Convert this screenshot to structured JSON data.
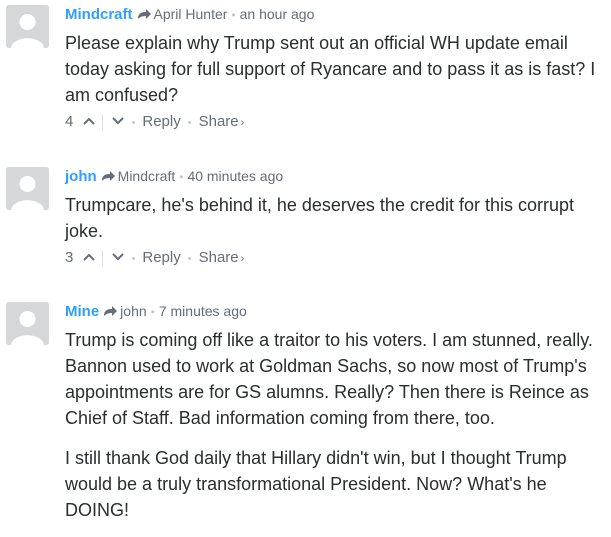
{
  "colors": {
    "author": "#2e9fff",
    "meta": "#656c7a",
    "text": "#2a2e2e",
    "avatar_bg": "#d5d7d8"
  },
  "comments": [
    {
      "author": "Mindcraft",
      "parent": "April Hunter",
      "time": "an hour ago",
      "paragraphs": [
        "Please explain why Trump sent out an official WH update email today asking for full support of Ryancare and to pass it as is fast? I am confused?"
      ],
      "upvotes": "4",
      "reply_label": "Reply",
      "share_label": "Share",
      "share_arrow": "›"
    },
    {
      "author": "john",
      "parent": "Mindcraft",
      "time": "40 minutes ago",
      "paragraphs": [
        "Trumpcare, he's behind it, he deserves the credit for this corrupt joke."
      ],
      "upvotes": "3",
      "reply_label": "Reply",
      "share_label": "Share",
      "share_arrow": "›"
    },
    {
      "author": "Mine",
      "parent": "john",
      "time": "7 minutes ago",
      "paragraphs": [
        "Trump is coming off like a traitor to his voters. I am stunned, really. Bannon used to work at Goldman Sachs, so now most of Trump's appointments are for GS alumns. Really? Then there is Reince as Chief of Staff. Bad information coming from there, too.",
        "I still thank God daily that Hillary didn't win, but I thought Trump would be a truly transformational President. Now? What's he DOING!"
      ]
    }
  ]
}
